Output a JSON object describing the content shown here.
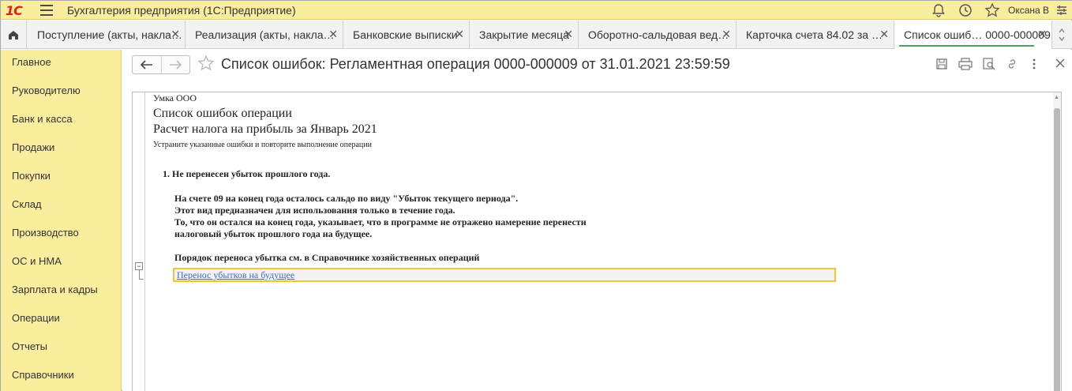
{
  "titlebar": {
    "app_title": "Бухгалтерия предприятия  (1С:Предприятие)",
    "user": "Оксана В"
  },
  "tabs": [
    {
      "label": "Поступление (акты, накла…",
      "close": "✕"
    },
    {
      "label": "Реализация (акты, накла…",
      "close": "✕"
    },
    {
      "label": "Банковские выписки",
      "close": "✕"
    },
    {
      "label": "Закрытие месяца",
      "close": "✕"
    },
    {
      "label": "Оборотно-сальдовая вед…",
      "close": "✕"
    },
    {
      "label": "Карточка счета 84.02 за …",
      "close": "✕"
    },
    {
      "label": "Список ошиб…  0000-000009",
      "close": "✕"
    }
  ],
  "sidebar": {
    "items": [
      {
        "label": "Главное"
      },
      {
        "label": "Руководителю"
      },
      {
        "label": "Банк и касса"
      },
      {
        "label": "Продажи"
      },
      {
        "label": "Покупки"
      },
      {
        "label": "Склад"
      },
      {
        "label": "Производство"
      },
      {
        "label": "ОС и НМА"
      },
      {
        "label": "Зарплата и кадры"
      },
      {
        "label": "Операции"
      },
      {
        "label": "Отчеты"
      },
      {
        "label": "Справочники"
      }
    ]
  },
  "form": {
    "title": "Список ошибок: Регламентная операция 0000-000009 от 31.01.2021 23:59:59"
  },
  "document": {
    "org": "Умка ООО",
    "heading1": "Список ошибок операции",
    "heading2": "Расчет налога на прибыль за Январь 2021",
    "note": "Устраните указанные ошибки и повторите выполнение операции",
    "error_item": "1. Не перенесен убыток прошлого года.",
    "lines": [
      "На счете 09 на конец года осталось сальдо по виду \"Убыток текущего периода\".",
      "Этот вид предназначен для использования только в течение года.",
      "То, что он остался на конец года, указывает, что в программе не отражено намерение перенести",
      "налоговый убыток прошлого года на будущее."
    ],
    "procedure": "Порядок переноса убытка см. в Справочнике хозяйственных операций",
    "link": "Перенос убытков на будущее"
  },
  "colors": {
    "accent_yellow": "#fbed9e",
    "active_tab_underline": "#42a85f",
    "highlight_border": "#f3c531",
    "link": "#3d6cc4"
  }
}
